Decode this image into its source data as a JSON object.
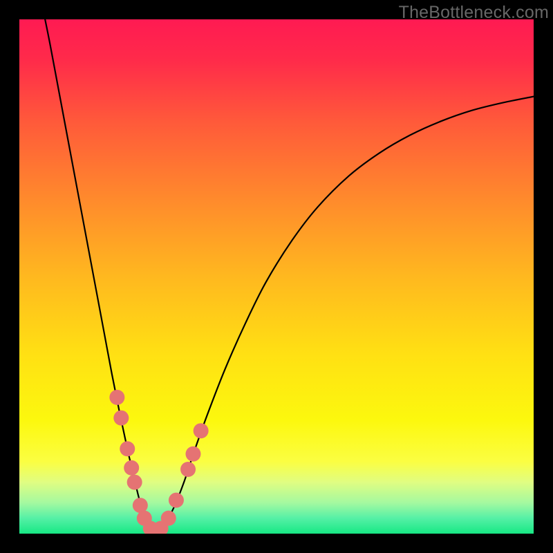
{
  "watermark": "TheBottleneck.com",
  "chart_data": {
    "type": "line",
    "title": "",
    "xlabel": "",
    "ylabel": "",
    "xlim": [
      0,
      100
    ],
    "ylim": [
      0,
      100
    ],
    "grid": false,
    "legend": false,
    "background_gradient": {
      "stops": [
        {
          "offset": 0.0,
          "color": "#ff1a52"
        },
        {
          "offset": 0.08,
          "color": "#ff2b4a"
        },
        {
          "offset": 0.2,
          "color": "#ff5a3a"
        },
        {
          "offset": 0.35,
          "color": "#ff8a2c"
        },
        {
          "offset": 0.5,
          "color": "#ffb81f"
        },
        {
          "offset": 0.65,
          "color": "#ffe013"
        },
        {
          "offset": 0.78,
          "color": "#fcf80e"
        },
        {
          "offset": 0.86,
          "color": "#fbfe42"
        },
        {
          "offset": 0.9,
          "color": "#e0fd82"
        },
        {
          "offset": 0.94,
          "color": "#a4f9a0"
        },
        {
          "offset": 0.97,
          "color": "#55f0a6"
        },
        {
          "offset": 1.0,
          "color": "#17e884"
        }
      ]
    },
    "series": [
      {
        "name": "left-curve",
        "color": "#000000",
        "points": [
          {
            "x": 5.0,
            "y": 100.0
          },
          {
            "x": 6.0,
            "y": 95.0
          },
          {
            "x": 7.5,
            "y": 87.0
          },
          {
            "x": 9.0,
            "y": 79.0
          },
          {
            "x": 10.5,
            "y": 71.0
          },
          {
            "x": 12.0,
            "y": 63.0
          },
          {
            "x": 13.5,
            "y": 55.0
          },
          {
            "x": 15.0,
            "y": 47.0
          },
          {
            "x": 16.5,
            "y": 39.0
          },
          {
            "x": 18.0,
            "y": 31.0
          },
          {
            "x": 19.5,
            "y": 23.5
          },
          {
            "x": 21.0,
            "y": 16.5
          },
          {
            "x": 22.5,
            "y": 10.0
          },
          {
            "x": 23.5,
            "y": 6.0
          },
          {
            "x": 24.5,
            "y": 3.0
          },
          {
            "x": 25.5,
            "y": 1.2
          },
          {
            "x": 26.5,
            "y": 0.5
          }
        ]
      },
      {
        "name": "right-curve",
        "color": "#000000",
        "points": [
          {
            "x": 26.5,
            "y": 0.5
          },
          {
            "x": 28.0,
            "y": 1.5
          },
          {
            "x": 30.0,
            "y": 5.0
          },
          {
            "x": 32.0,
            "y": 10.0
          },
          {
            "x": 34.0,
            "y": 16.0
          },
          {
            "x": 36.5,
            "y": 23.0
          },
          {
            "x": 40.0,
            "y": 32.0
          },
          {
            "x": 44.0,
            "y": 41.0
          },
          {
            "x": 48.0,
            "y": 49.0
          },
          {
            "x": 53.0,
            "y": 57.0
          },
          {
            "x": 58.0,
            "y": 63.5
          },
          {
            "x": 64.0,
            "y": 69.5
          },
          {
            "x": 70.0,
            "y": 74.0
          },
          {
            "x": 76.0,
            "y": 77.5
          },
          {
            "x": 82.0,
            "y": 80.2
          },
          {
            "x": 88.0,
            "y": 82.3
          },
          {
            "x": 94.0,
            "y": 83.8
          },
          {
            "x": 100.0,
            "y": 85.0
          }
        ]
      }
    ],
    "markers": {
      "name": "highlight-dots",
      "color": "#e57373",
      "radius": 11,
      "points": [
        {
          "x": 19.0,
          "y": 26.5
        },
        {
          "x": 19.8,
          "y": 22.5
        },
        {
          "x": 21.0,
          "y": 16.5
        },
        {
          "x": 21.8,
          "y": 12.8
        },
        {
          "x": 22.4,
          "y": 10.0
        },
        {
          "x": 23.5,
          "y": 5.5
        },
        {
          "x": 24.3,
          "y": 3.0
        },
        {
          "x": 25.5,
          "y": 1.0
        },
        {
          "x": 27.5,
          "y": 1.0
        },
        {
          "x": 29.0,
          "y": 3.0
        },
        {
          "x": 30.5,
          "y": 6.5
        },
        {
          "x": 32.8,
          "y": 12.5
        },
        {
          "x": 33.8,
          "y": 15.5
        },
        {
          "x": 35.3,
          "y": 20.0
        }
      ]
    }
  }
}
